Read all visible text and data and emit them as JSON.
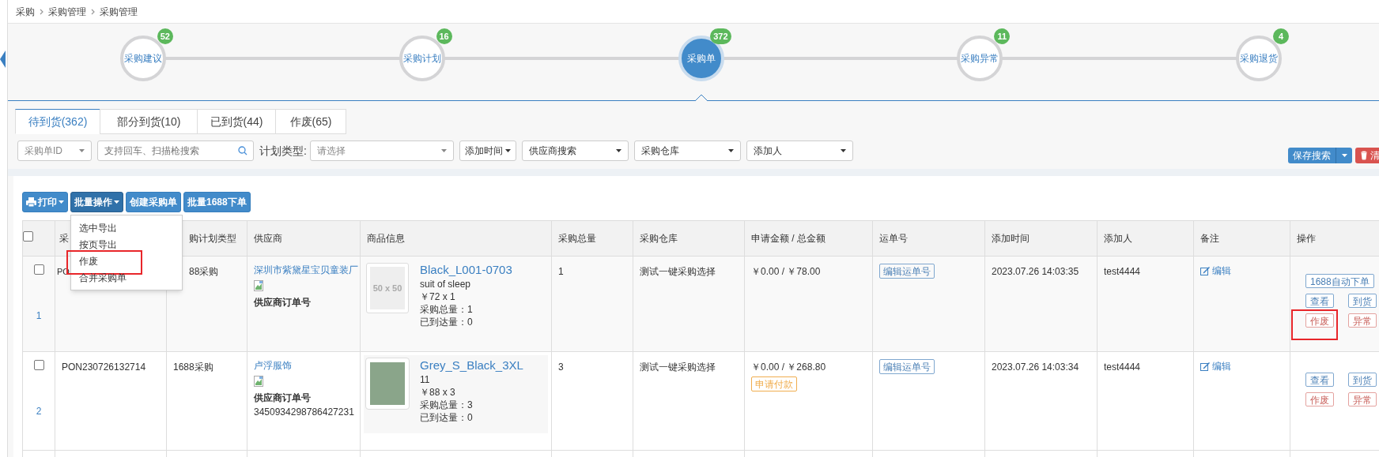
{
  "breadcrumb": [
    "采购",
    "采购管理",
    "采购管理"
  ],
  "steps": [
    {
      "label": "采购建议",
      "count": "52",
      "selected": false
    },
    {
      "label": "采购计划",
      "count": "16",
      "selected": false
    },
    {
      "label": "采购单",
      "count": "372",
      "selected": true
    },
    {
      "label": "采购异常",
      "count": "11",
      "selected": false
    },
    {
      "label": "采购退货",
      "count": "4",
      "selected": false
    }
  ],
  "tabs": [
    {
      "label": "待到货(362)",
      "selected": true
    },
    {
      "label": "部分到货(10)",
      "selected": false
    },
    {
      "label": "已到货(44)",
      "selected": false
    },
    {
      "label": "作废(65)",
      "selected": false
    }
  ],
  "filters": [
    {
      "kind": "select",
      "placeholder": "采购单ID"
    },
    {
      "kind": "search",
      "placeholder": "支持回车、扫描枪搜索"
    },
    {
      "kind": "label",
      "text": "计划类型:"
    },
    {
      "kind": "wideselect",
      "placeholder": "请选择"
    },
    {
      "kind": "button",
      "text": "添加时间"
    },
    {
      "kind": "select",
      "text": "供应商搜索"
    },
    {
      "kind": "select",
      "text": "采购仓库"
    },
    {
      "kind": "select",
      "text": "添加人"
    }
  ],
  "search_actions": [
    {
      "kind": "split",
      "label": "保存搜索"
    },
    {
      "kind": "danger",
      "label": "清"
    }
  ],
  "toolbar": [
    {
      "kind": "print",
      "label": "打印",
      "dropdown": true,
      "open": false
    },
    {
      "kind": "plain",
      "label": "批量操作",
      "dropdown": true,
      "open": true
    },
    {
      "kind": "plain",
      "label": "创建采购单",
      "dropdown": false,
      "open": false
    },
    {
      "kind": "plain",
      "label": "批量1688下单",
      "dropdown": false,
      "open": false
    }
  ],
  "menu": [
    {
      "label": "选中导出",
      "highlighted": false
    },
    {
      "label": "按页导出",
      "highlighted": false
    },
    {
      "label": "作废",
      "highlighted": true
    },
    {
      "label": "合并采购单",
      "highlighted": false
    }
  ],
  "table": {
    "columns": [
      {
        "kind": "checkbox",
        "checked": false
      },
      {
        "label": "采"
      },
      {
        "label": "购计划类型"
      },
      {
        "label": "供应商"
      },
      {
        "label": "商品信息"
      },
      {
        "label": "采购总量"
      },
      {
        "label": "采购仓库"
      },
      {
        "label": "申请金额 / 总金额"
      },
      {
        "label": "运单号"
      },
      {
        "label": "添加时间"
      },
      {
        "label": "添加人"
      },
      {
        "label": "备注"
      },
      {
        "label": "操作"
      }
    ],
    "rows": [
      {
        "checked": false,
        "index": "1",
        "order_no": "PO",
        "plan_type": "88采购",
        "supplier": "深圳市紫黛星宝贝童装厂",
        "supplier_order_label": "供应商订单号",
        "product": {
          "kind": "placeholder",
          "image_text": "50 x 50",
          "name": "Black_L001-0703",
          "subtitle": "suit of sleep",
          "price": "￥72 x 1",
          "total": "采购总量：1",
          "arrived": "已到达量：0"
        },
        "quantity": "1",
        "warehouse": "测试一键采购选择",
        "amount": "￥0.00 / ￥78.00",
        "waybill_button": "编辑运单号",
        "added_time": "2023.07.26 14:03:35",
        "added_by": "test4444",
        "note_link": "编辑",
        "action_rows": [
          [
            {
              "label": "1688自动下单",
              "kind": "primary",
              "highlighted": false
            }
          ],
          [
            {
              "label": "查看",
              "kind": "primary",
              "highlighted": false
            },
            {
              "label": "到货",
              "kind": "primary",
              "highlighted": false
            }
          ],
          [
            {
              "label": "作废",
              "kind": "danger",
              "highlighted": true
            },
            {
              "label": "异常",
              "kind": "danger",
              "highlighted": false
            }
          ]
        ]
      },
      {
        "checked": false,
        "index": "2",
        "order_no": "PON230726132714",
        "plan_type": "1688采购",
        "supplier": "卢浮服饰",
        "supplier_order_label": "供应商订单号",
        "supplier_order_no": "3450934298786427231",
        "product": {
          "kind": "photo",
          "name": "Grey_S_Black_3XL",
          "subtitle": "11",
          "price": "￥88 x 3",
          "total": "采购总量：3",
          "arrived": "已到达量：0"
        },
        "quantity": "3",
        "warehouse": "测试一键采购选择",
        "amount": "￥0.00 / ￥268.80",
        "pay_request": "申请付款",
        "waybill_button": "编辑运单号",
        "added_time": "2023.07.26 14:03:34",
        "added_by": "test4444",
        "note_link": "编辑",
        "action_rows": [
          [
            {
              "label": "查看",
              "kind": "primary",
              "highlighted": false
            },
            {
              "label": "到货",
              "kind": "primary",
              "highlighted": false
            }
          ],
          [
            {
              "label": "作废",
              "kind": "danger",
              "highlighted": false
            },
            {
              "label": "异常",
              "kind": "danger",
              "highlighted": false
            }
          ]
        ]
      }
    ]
  }
}
